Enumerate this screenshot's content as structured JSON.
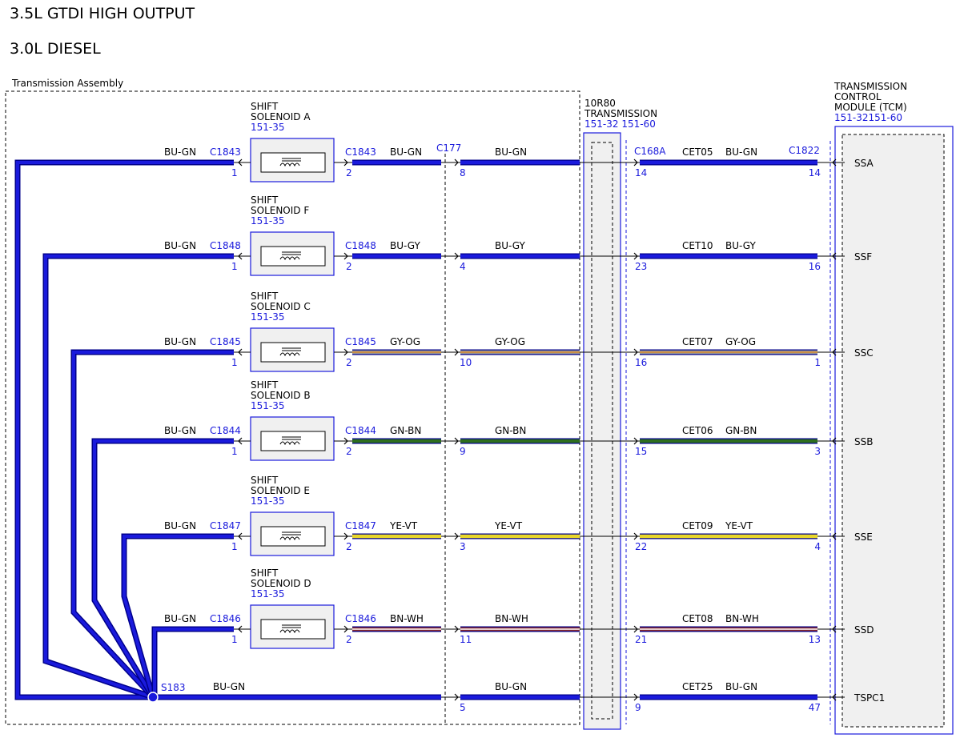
{
  "titles": [
    "3.5L GTDI HIGH OUTPUT",
    "3.0L DIESEL"
  ],
  "assembly_label": "Transmission Assembly",
  "transmission": {
    "lines": [
      "10R80",
      "TRANSMISSION"
    ],
    "ref": "151-32 151-60"
  },
  "tcm": {
    "lines": [
      "TRANSMISSION",
      "CONTROL",
      "MODULE (TCM)"
    ],
    "ref": "151-32151-60"
  },
  "splice": {
    "id": "S183",
    "color": "BU-GN"
  },
  "c177": "C177",
  "c168a": "C168A",
  "c1822": "C1822",
  "solenoid_lines": [
    "SHIFT"
  ],
  "colors": {
    "blue": "#1a1adc",
    "dark_blue": "#00008b",
    "BU-GN": [
      "#1a1adc",
      "#1a1adc"
    ],
    "BU-GY": [
      "#1a1adc",
      "#1a1adc"
    ],
    "GY-OG": [
      "#9a9a9a",
      "#d98a2a"
    ],
    "GN-BN": [
      "#2e6e1e",
      "#2e6e1e"
    ],
    "YE-VT": [
      "#e8d62a",
      "#e8d62a"
    ],
    "BN-WH": [
      "#8e2b2b",
      "#ffffff"
    ]
  },
  "circuits": [
    {
      "solenoid": "SHIFT SOLENOID A",
      "sol_line2": "SOLENOID A",
      "sol_ref": "151-35",
      "left_color": "BU-GN",
      "conn": "C1843",
      "pin_left": "1",
      "pin_right": "2",
      "color": "BU-GN",
      "c177_pin": "8",
      "tr_pin": "14",
      "cet": "CET05",
      "tcm_pin": "14",
      "tcm_signal": "SSA"
    },
    {
      "solenoid": "SHIFT SOLENOID F",
      "sol_line2": "SOLENOID F",
      "sol_ref": "151-35",
      "left_color": "BU-GN",
      "conn": "C1848",
      "pin_left": "1",
      "pin_right": "2",
      "color": "BU-GY",
      "c177_pin": "4",
      "tr_pin": "23",
      "cet": "CET10",
      "tcm_pin": "16",
      "tcm_signal": "SSF"
    },
    {
      "solenoid": "SHIFT SOLENOID C",
      "sol_line2": "SOLENOID C",
      "sol_ref": "151-35",
      "left_color": "BU-GN",
      "conn": "C1845",
      "pin_left": "1",
      "pin_right": "2",
      "color": "GY-OG",
      "c177_pin": "10",
      "tr_pin": "16",
      "cet": "CET07",
      "tcm_pin": "1",
      "tcm_signal": "SSC"
    },
    {
      "solenoid": "SHIFT SOLENOID B",
      "sol_line2": "SOLENOID B",
      "sol_ref": "151-35",
      "left_color": "BU-GN",
      "conn": "C1844",
      "pin_left": "1",
      "pin_right": "2",
      "color": "GN-BN",
      "c177_pin": "9",
      "tr_pin": "15",
      "cet": "CET06",
      "tcm_pin": "3",
      "tcm_signal": "SSB"
    },
    {
      "solenoid": "SHIFT SOLENOID E",
      "sol_line2": "SOLENOID E",
      "sol_ref": "151-35",
      "left_color": "BU-GN",
      "conn": "C1847",
      "pin_left": "1",
      "pin_right": "2",
      "color": "YE-VT",
      "c177_pin": "3",
      "tr_pin": "22",
      "cet": "CET09",
      "tcm_pin": "4",
      "tcm_signal": "SSE"
    },
    {
      "solenoid": "SHIFT SOLENOID D",
      "sol_line2": "SOLENOID D",
      "sol_ref": "151-35",
      "left_color": "BU-GN",
      "conn": "C1846",
      "pin_left": "1",
      "pin_right": "2",
      "color": "BN-WH",
      "c177_pin": "11",
      "tr_pin": "21",
      "cet": "CET08",
      "tcm_pin": "13",
      "tcm_signal": "SSD"
    }
  ],
  "common": {
    "color": "BU-GN",
    "c177_pin": "5",
    "tr_pin": "9",
    "cet": "CET25",
    "tcm_pin": "47",
    "tcm_signal": "TSPC1"
  }
}
